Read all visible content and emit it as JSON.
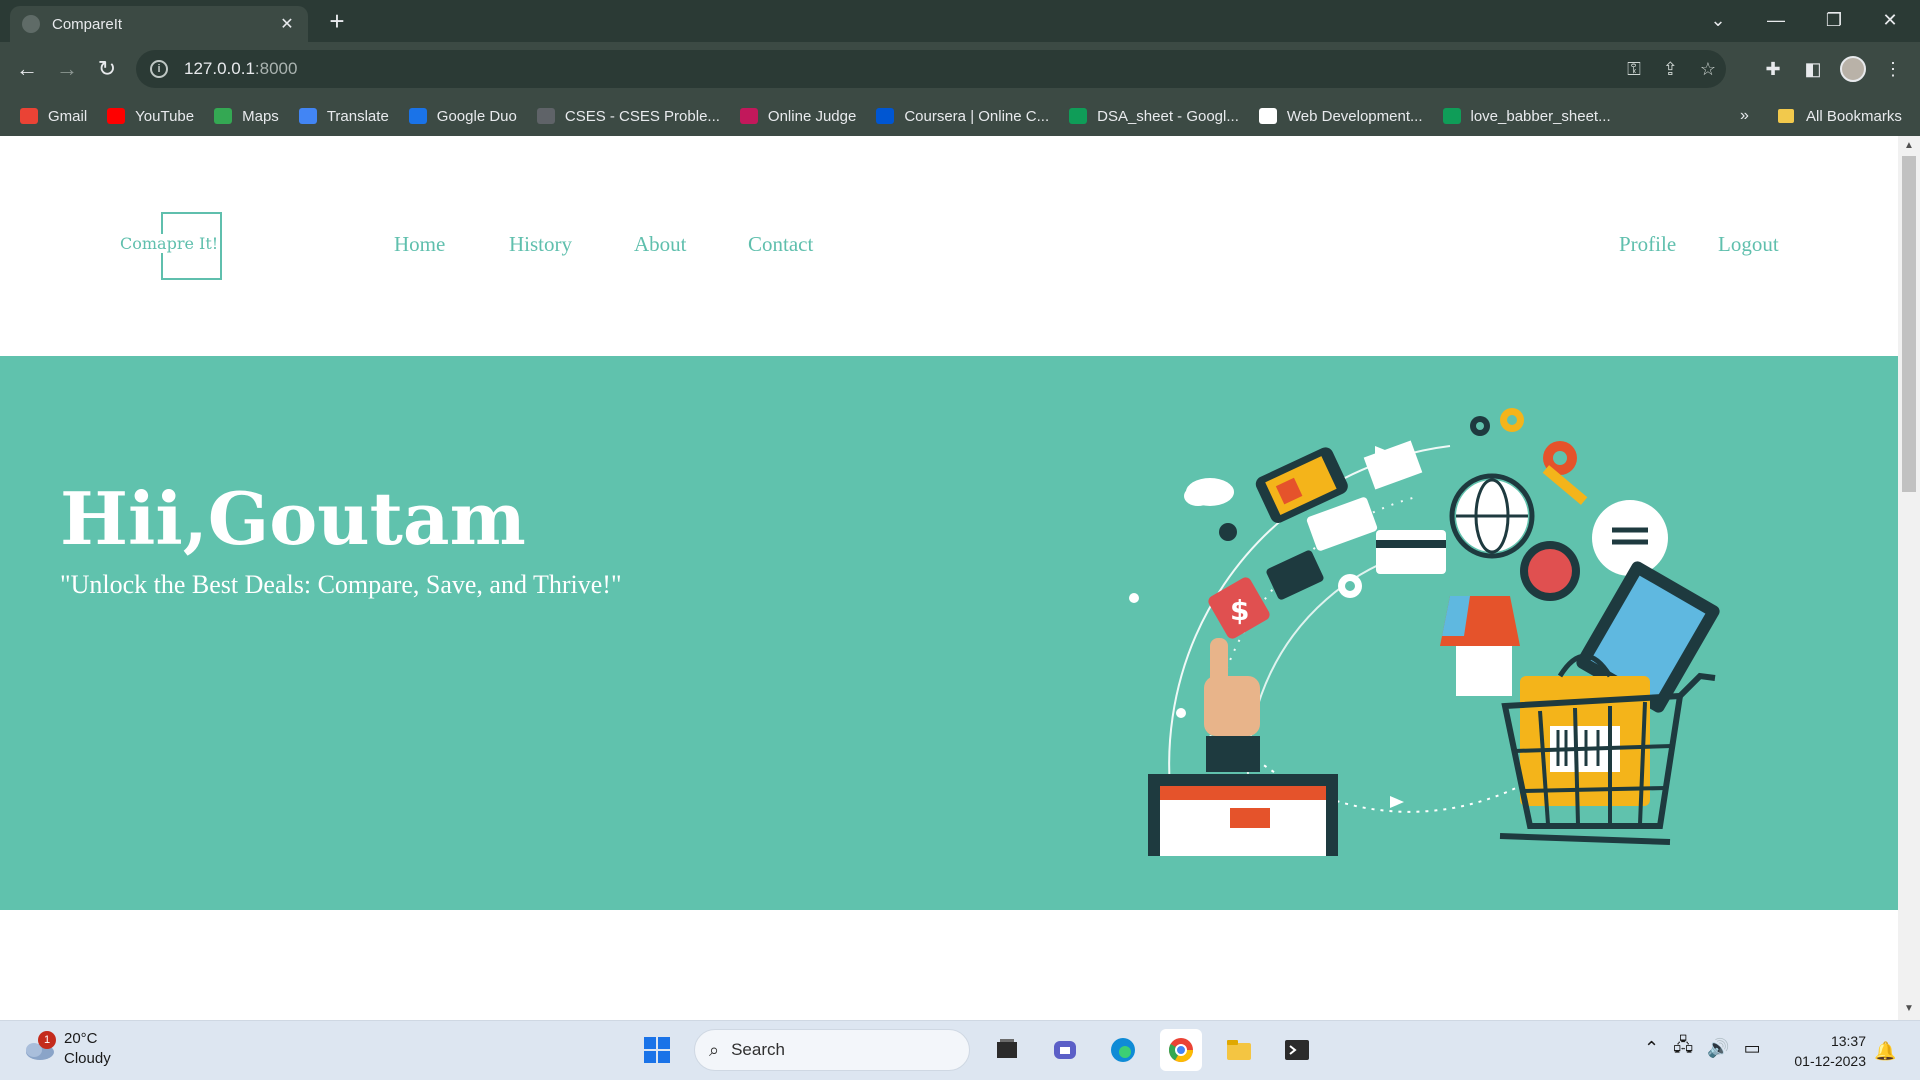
{
  "browser": {
    "tab_title": "CompareIt",
    "tab_close": "✕",
    "new_tab": "+",
    "url_host": "127.0.0.1",
    "url_port": ":8000",
    "bookmarks": [
      {
        "label": "Gmail",
        "icon": "gmail-icon",
        "color": "#ea4335"
      },
      {
        "label": "YouTube",
        "icon": "youtube-icon",
        "color": "#ff0000"
      },
      {
        "label": "Maps",
        "icon": "maps-icon",
        "color": "#34a853"
      },
      {
        "label": "Translate",
        "icon": "translate-icon",
        "color": "#4285f4"
      },
      {
        "label": "Google Duo",
        "icon": "duo-icon",
        "color": "#1a73e8"
      },
      {
        "label": "CSES - CSES Proble...",
        "icon": "globe-icon",
        "color": "#5f6368"
      },
      {
        "label": "Online Judge",
        "icon": "uva-icon",
        "color": "#c2185b"
      },
      {
        "label": "Coursera | Online C...",
        "icon": "coursera-icon",
        "color": "#0056d2"
      },
      {
        "label": "DSA_sheet - Googl...",
        "icon": "sheets-icon",
        "color": "#0f9d58"
      },
      {
        "label": "Web Development...",
        "icon": "webdev-icon",
        "color": "#ffffff"
      },
      {
        "label": "love_babber_sheet...",
        "icon": "sheets-icon",
        "color": "#0f9d58"
      }
    ],
    "bookmarks_more": "»",
    "all_bookmarks": "All Bookmarks"
  },
  "site": {
    "logo_text": "Comapre It!",
    "nav": [
      "Home",
      "History",
      "About",
      "Contact"
    ],
    "nav_right": [
      "Profile",
      "Logout"
    ],
    "greeting": "Hii,Goutam",
    "tagline": "\"Unlock the Best Deals: Compare, Save, and Thrive!\"",
    "accent_color": "#60c2ad",
    "illustration": "ecommerce-shopping-illustration"
  },
  "taskbar": {
    "weather_temp": "20°C",
    "weather_desc": "Cloudy",
    "weather_badge": "1",
    "search_label": "Search",
    "time": "13:37",
    "date": "01-12-2023"
  }
}
